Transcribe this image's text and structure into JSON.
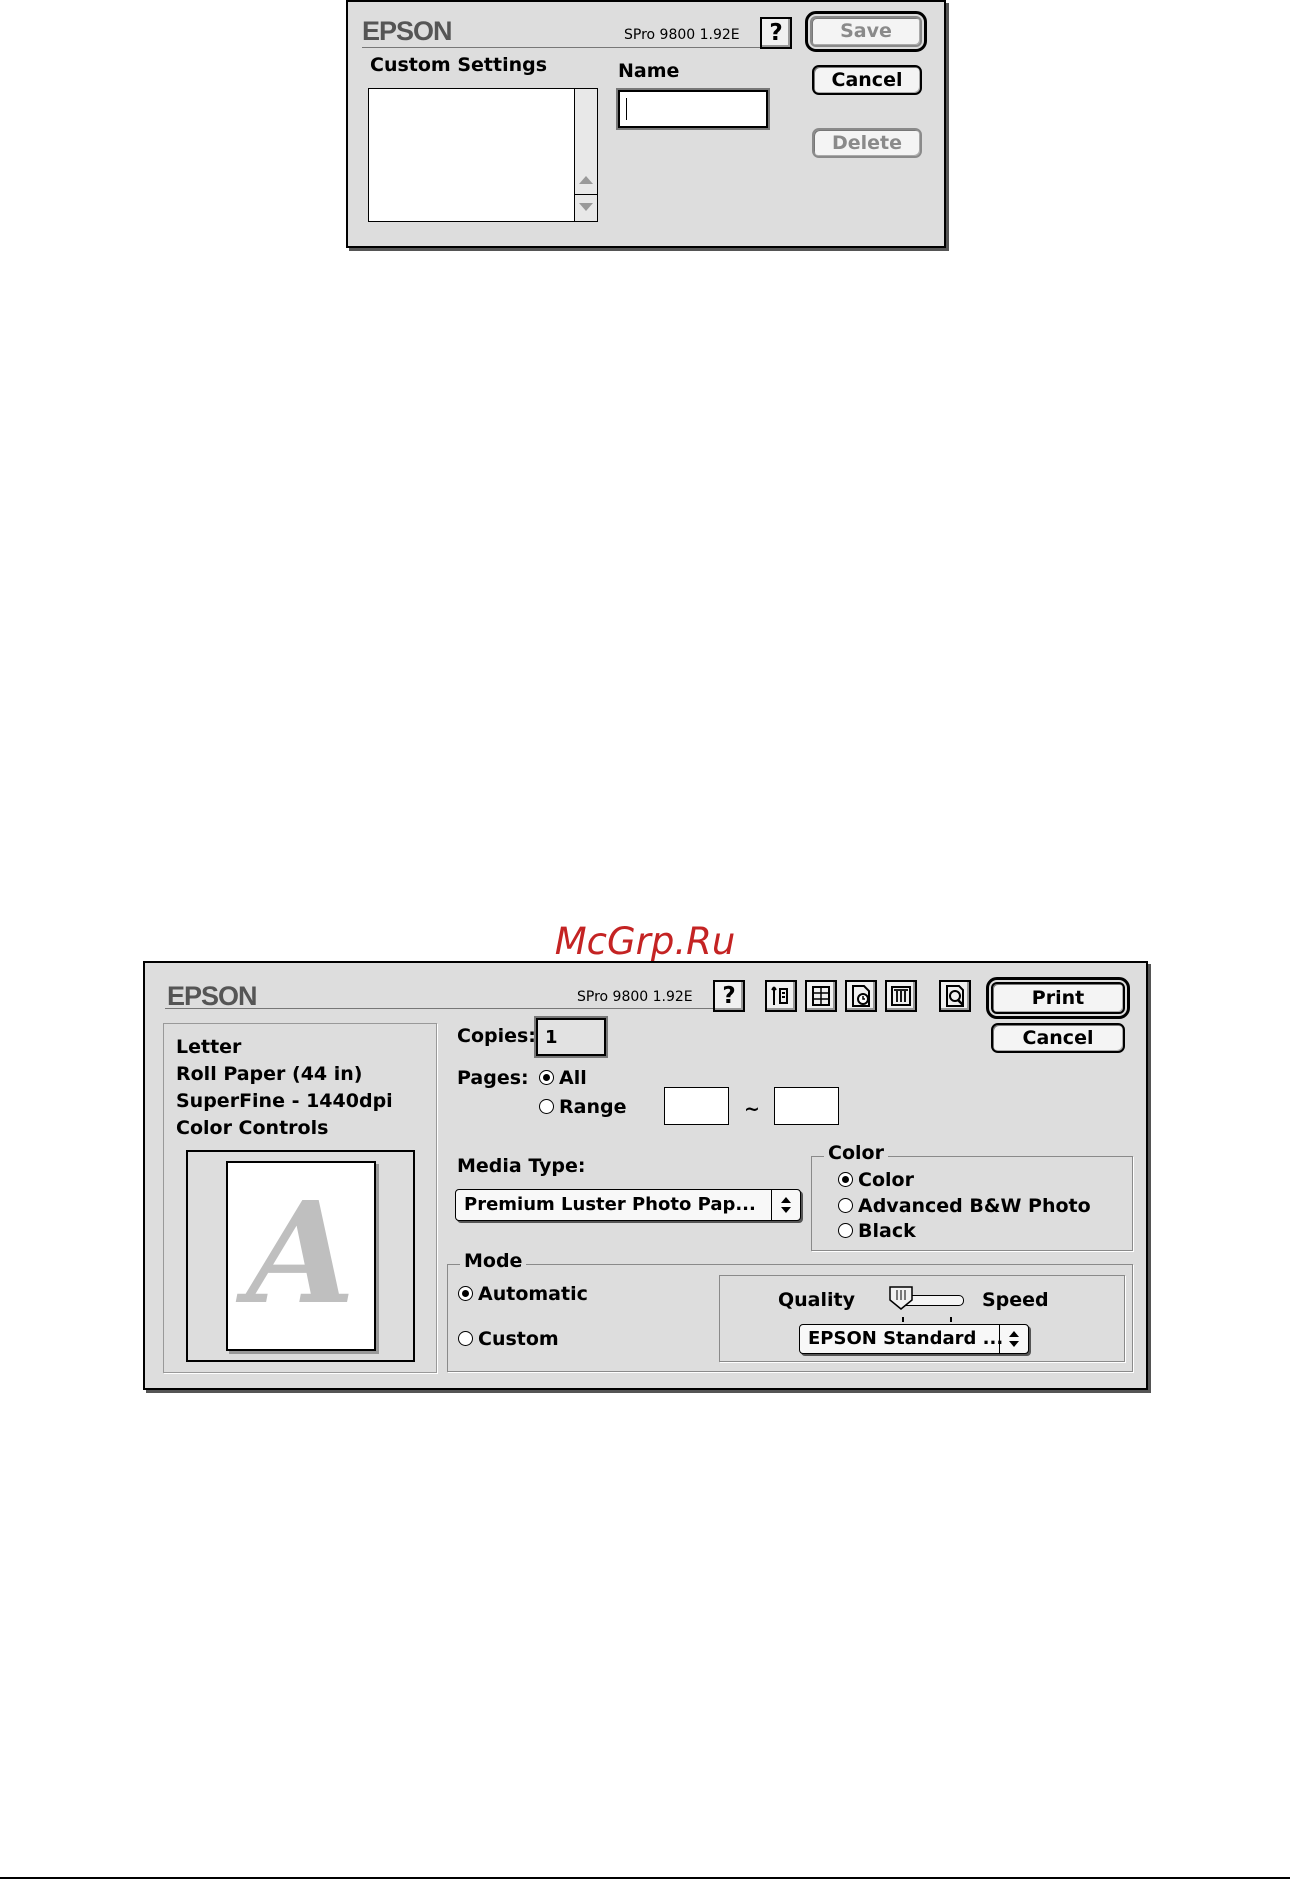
{
  "watermark": "McGrp.Ru",
  "custom_settings_dialog": {
    "brand": "EPSON",
    "version": "SPro 9800 1.92E",
    "help_label": "?",
    "list_label": "Custom Settings",
    "name_label": "Name",
    "name_value": "",
    "buttons": {
      "save": "Save",
      "cancel": "Cancel",
      "delete": "Delete"
    }
  },
  "print_dialog": {
    "brand": "EPSON",
    "version": "SPro 9800 1.92E",
    "help_label": "?",
    "summary": [
      "Letter",
      "Roll Paper (44 in)",
      "SuperFine - 1440dpi",
      "Color Controls"
    ],
    "preview_letter": "A",
    "toolbar_icons": [
      "utility-icon",
      "layout-icon",
      "background-print-icon",
      "print-monitor-icon",
      "preview-icon"
    ],
    "print_button": "Print",
    "cancel_button": "Cancel",
    "copies_label": "Copies:",
    "copies_value": "1",
    "pages_label": "Pages:",
    "pages_all": "All",
    "pages_range": "Range",
    "range_sep": "~",
    "media_type_label": "Media Type:",
    "media_type_value": "Premium Luster Photo Pap...",
    "color_group": "Color",
    "color_options": [
      "Color",
      "Advanced B&W Photo",
      "Black"
    ],
    "mode_group": "Mode",
    "mode_automatic": "Automatic",
    "mode_custom": "Custom",
    "quality_label": "Quality",
    "speed_label": "Speed",
    "quality_preset": "EPSON Standard ..."
  }
}
